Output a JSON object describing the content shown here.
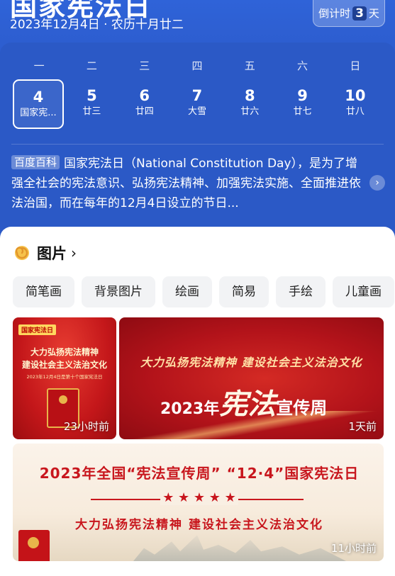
{
  "header": {
    "title": "国家宪法日",
    "date_line": "2023年12月4日 · 农历十月廿二",
    "countdown": {
      "prefix": "倒计时",
      "number": "3",
      "suffix": "天"
    }
  },
  "calendar": {
    "weekdays": [
      "一",
      "二",
      "三",
      "四",
      "五",
      "六",
      "日"
    ],
    "days": [
      {
        "day": "4",
        "label": "国家宪...",
        "selected": true
      },
      {
        "day": "5",
        "label": "廿三"
      },
      {
        "day": "6",
        "label": "廿四"
      },
      {
        "day": "7",
        "label": "大雪"
      },
      {
        "day": "8",
        "label": "廿六"
      },
      {
        "day": "9",
        "label": "廿七"
      },
      {
        "day": "10",
        "label": "廿八"
      }
    ]
  },
  "baike": {
    "badge": "百度百科",
    "text": "国家宪法日（National Constitution Day），是为了增强全社会的宪法意识、弘扬宪法精神、加强宪法实施、全面推进依法治国，而在每年的12月4日设立的节日..."
  },
  "images_section": {
    "title": "图片",
    "chips": [
      "简笔画",
      "背景图片",
      "绘画",
      "简易",
      "手绘",
      "儿童画"
    ],
    "images": [
      {
        "age": "23小时前",
        "tag": "国家宪法日",
        "line1": "大力弘扬宪法精神",
        "line2": "建设社会主义法治文化",
        "sub": "2023年12月4日是第十个国家宪法日"
      },
      {
        "age": "1天前",
        "slogan": "大力弘扬宪法精神  建设社会主义法治文化",
        "year": "2023年",
        "big": "宪法",
        "week": "宣传周"
      },
      {
        "age": "11小时前",
        "title": "2023年全国“宪法宣传周” “12·4”国家宪法日",
        "stars": "★ ★ ★ ★ ★",
        "slogan": "大力弘扬宪法精神  建设社会主义法治文化"
      }
    ]
  },
  "colors": {
    "hero_blue": "#2b59c6",
    "poster_red": "#c4171a",
    "title_red": "#c8161d"
  },
  "icons": {
    "section_icon": "swirl-icon",
    "baike_more": "chevron-right-icon"
  }
}
